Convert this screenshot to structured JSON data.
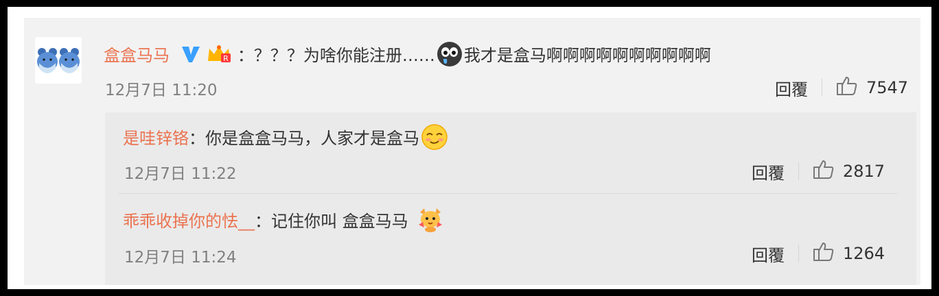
{
  "comment": {
    "username": "盒盒马马",
    "text_part1": "：？？？为啥你能注册……",
    "text_part2": "我才是盒马啊啊啊啊啊啊啊啊啊啊",
    "time": "12月7日 11:20",
    "reply_label": "回覆",
    "like_count": "7547"
  },
  "replies": [
    {
      "username": "是哇锌铬",
      "text": "：你是盒盒马马，人家才是盒马",
      "time": "12月7日 11:22",
      "reply_label": "回覆",
      "like_count": "2817"
    },
    {
      "username": "乖乖收掉你的怯__",
      "text": "：记住你叫 盒盒马马",
      "time": "12月7日 11:24",
      "reply_label": "回覆",
      "like_count": "1264"
    }
  ],
  "icons": {
    "verified": "v-verified-icon",
    "crown": "crown-badge-icon",
    "cry_emoji": "crying-emoji-icon",
    "smile_emoji": "smirk-emoji-icon",
    "cute_emoji": "cute-animal-emoji-icon",
    "thumbs_up": "thumbs-up-icon"
  },
  "colors": {
    "username": "#eb7350",
    "verified": "#3aa0ff",
    "text": "#333333",
    "meta": "#808080"
  }
}
